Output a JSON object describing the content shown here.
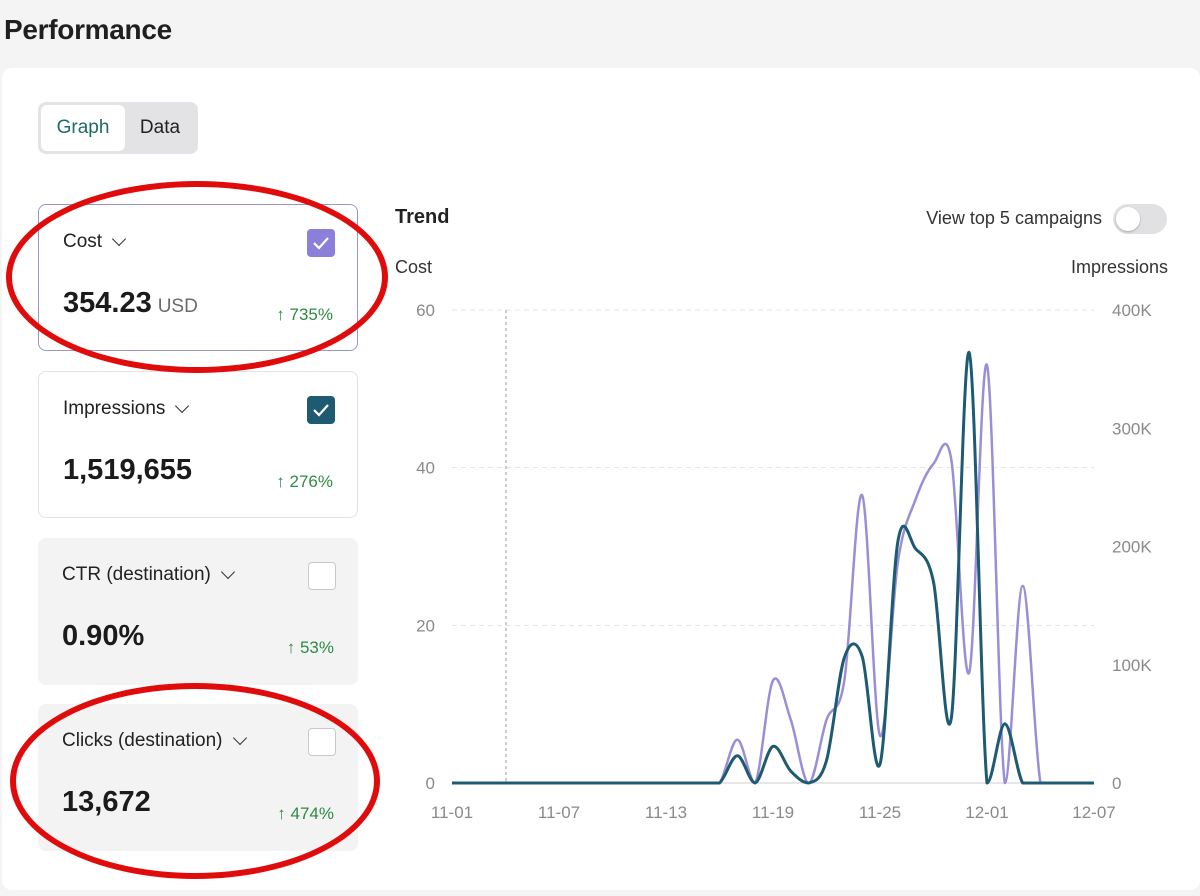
{
  "page": {
    "title": "Performance"
  },
  "view_toggle": {
    "graph_label": "Graph",
    "data_label": "Data",
    "active": "Graph"
  },
  "metrics": [
    {
      "label": "Cost",
      "value": "354.23",
      "unit": "USD",
      "delta": "↑ 735%",
      "checked": true,
      "check_color": "#8c7fd9"
    },
    {
      "label": "Impressions",
      "value": "1,519,655",
      "unit": "",
      "delta": "↑ 276%",
      "checked": true,
      "check_color": "#1e5b73"
    },
    {
      "label": "CTR (destination)",
      "value": "0.90%",
      "unit": "",
      "delta": "↑ 53%",
      "checked": false
    },
    {
      "label": "Clicks (destination)",
      "value": "13,672",
      "unit": "",
      "delta": "↑ 474%",
      "checked": false
    }
  ],
  "trend": {
    "title": "Trend",
    "top_campaigns_label": "View top 5 campaigns",
    "top_campaigns_enabled": false
  },
  "chart_data": {
    "type": "line",
    "ylabel": "Cost",
    "y2label": "Impressions",
    "ylim": [
      0,
      60
    ],
    "y2lim": [
      0,
      400000
    ],
    "yticks": [
      "60",
      "40",
      "20",
      "0"
    ],
    "y2ticks": [
      "400K",
      "300K",
      "200K",
      "100K",
      "0"
    ],
    "xticks": [
      "11-01",
      "11-07",
      "11-13",
      "11-19",
      "11-25",
      "12-01",
      "12-07"
    ],
    "x": [
      "11-01",
      "11-02",
      "11-03",
      "11-04",
      "11-05",
      "11-06",
      "11-07",
      "11-08",
      "11-09",
      "11-10",
      "11-11",
      "11-12",
      "11-13",
      "11-14",
      "11-15",
      "11-16",
      "11-17",
      "11-18",
      "11-19",
      "11-20",
      "11-21",
      "11-22",
      "11-23",
      "11-24",
      "11-25",
      "11-26",
      "11-27",
      "11-28",
      "11-29",
      "11-30",
      "12-01",
      "12-02",
      "12-03",
      "12-04",
      "12-05",
      "12-06",
      "12-07"
    ],
    "series": [
      {
        "name": "Cost",
        "axis": "left",
        "color": "#9a8fd6",
        "values": [
          0,
          0,
          0,
          0,
          0,
          0,
          0,
          0,
          0,
          0,
          0,
          0,
          0,
          0,
          0,
          0,
          5.5,
          0,
          13,
          8,
          0,
          8,
          13,
          36.5,
          6,
          28,
          36,
          40.5,
          41,
          14,
          53,
          0,
          25,
          0,
          0,
          0,
          0
        ]
      },
      {
        "name": "Impressions",
        "axis": "right",
        "color": "#1e5b73",
        "values": [
          0,
          0,
          0,
          0,
          0,
          0,
          0,
          0,
          0,
          0,
          0,
          0,
          0,
          0,
          0,
          0,
          23000,
          0,
          31000,
          10000,
          0,
          19000,
          106000,
          107000,
          16000,
          204000,
          198000,
          170000,
          55000,
          364000,
          0,
          50000,
          0,
          0,
          0,
          0,
          0
        ]
      }
    ],
    "grid": true
  },
  "colors": {
    "accent": "#1d6b6b",
    "positive": "#2e8b45",
    "highlight": "#e00b0b"
  }
}
